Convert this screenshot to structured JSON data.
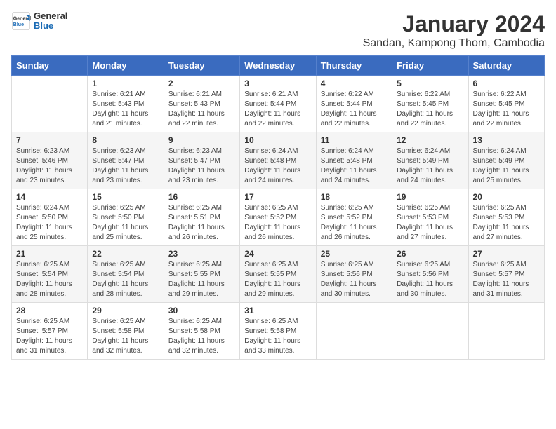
{
  "logo": {
    "general": "General",
    "blue": "Blue"
  },
  "title": "January 2024",
  "location": "Sandan, Kampong Thom, Cambodia",
  "days_of_week": [
    "Sunday",
    "Monday",
    "Tuesday",
    "Wednesday",
    "Thursday",
    "Friday",
    "Saturday"
  ],
  "weeks": [
    [
      {
        "day": "",
        "info": ""
      },
      {
        "day": "1",
        "info": "Sunrise: 6:21 AM\nSunset: 5:43 PM\nDaylight: 11 hours\nand 21 minutes."
      },
      {
        "day": "2",
        "info": "Sunrise: 6:21 AM\nSunset: 5:43 PM\nDaylight: 11 hours\nand 22 minutes."
      },
      {
        "day": "3",
        "info": "Sunrise: 6:21 AM\nSunset: 5:44 PM\nDaylight: 11 hours\nand 22 minutes."
      },
      {
        "day": "4",
        "info": "Sunrise: 6:22 AM\nSunset: 5:44 PM\nDaylight: 11 hours\nand 22 minutes."
      },
      {
        "day": "5",
        "info": "Sunrise: 6:22 AM\nSunset: 5:45 PM\nDaylight: 11 hours\nand 22 minutes."
      },
      {
        "day": "6",
        "info": "Sunrise: 6:22 AM\nSunset: 5:45 PM\nDaylight: 11 hours\nand 22 minutes."
      }
    ],
    [
      {
        "day": "7",
        "info": "Sunrise: 6:23 AM\nSunset: 5:46 PM\nDaylight: 11 hours\nand 23 minutes."
      },
      {
        "day": "8",
        "info": "Sunrise: 6:23 AM\nSunset: 5:47 PM\nDaylight: 11 hours\nand 23 minutes."
      },
      {
        "day": "9",
        "info": "Sunrise: 6:23 AM\nSunset: 5:47 PM\nDaylight: 11 hours\nand 23 minutes."
      },
      {
        "day": "10",
        "info": "Sunrise: 6:24 AM\nSunset: 5:48 PM\nDaylight: 11 hours\nand 24 minutes."
      },
      {
        "day": "11",
        "info": "Sunrise: 6:24 AM\nSunset: 5:48 PM\nDaylight: 11 hours\nand 24 minutes."
      },
      {
        "day": "12",
        "info": "Sunrise: 6:24 AM\nSunset: 5:49 PM\nDaylight: 11 hours\nand 24 minutes."
      },
      {
        "day": "13",
        "info": "Sunrise: 6:24 AM\nSunset: 5:49 PM\nDaylight: 11 hours\nand 25 minutes."
      }
    ],
    [
      {
        "day": "14",
        "info": "Sunrise: 6:24 AM\nSunset: 5:50 PM\nDaylight: 11 hours\nand 25 minutes."
      },
      {
        "day": "15",
        "info": "Sunrise: 6:25 AM\nSunset: 5:50 PM\nDaylight: 11 hours\nand 25 minutes."
      },
      {
        "day": "16",
        "info": "Sunrise: 6:25 AM\nSunset: 5:51 PM\nDaylight: 11 hours\nand 26 minutes."
      },
      {
        "day": "17",
        "info": "Sunrise: 6:25 AM\nSunset: 5:52 PM\nDaylight: 11 hours\nand 26 minutes."
      },
      {
        "day": "18",
        "info": "Sunrise: 6:25 AM\nSunset: 5:52 PM\nDaylight: 11 hours\nand 26 minutes."
      },
      {
        "day": "19",
        "info": "Sunrise: 6:25 AM\nSunset: 5:53 PM\nDaylight: 11 hours\nand 27 minutes."
      },
      {
        "day": "20",
        "info": "Sunrise: 6:25 AM\nSunset: 5:53 PM\nDaylight: 11 hours\nand 27 minutes."
      }
    ],
    [
      {
        "day": "21",
        "info": "Sunrise: 6:25 AM\nSunset: 5:54 PM\nDaylight: 11 hours\nand 28 minutes."
      },
      {
        "day": "22",
        "info": "Sunrise: 6:25 AM\nSunset: 5:54 PM\nDaylight: 11 hours\nand 28 minutes."
      },
      {
        "day": "23",
        "info": "Sunrise: 6:25 AM\nSunset: 5:55 PM\nDaylight: 11 hours\nand 29 minutes."
      },
      {
        "day": "24",
        "info": "Sunrise: 6:25 AM\nSunset: 5:55 PM\nDaylight: 11 hours\nand 29 minutes."
      },
      {
        "day": "25",
        "info": "Sunrise: 6:25 AM\nSunset: 5:56 PM\nDaylight: 11 hours\nand 30 minutes."
      },
      {
        "day": "26",
        "info": "Sunrise: 6:25 AM\nSunset: 5:56 PM\nDaylight: 11 hours\nand 30 minutes."
      },
      {
        "day": "27",
        "info": "Sunrise: 6:25 AM\nSunset: 5:57 PM\nDaylight: 11 hours\nand 31 minutes."
      }
    ],
    [
      {
        "day": "28",
        "info": "Sunrise: 6:25 AM\nSunset: 5:57 PM\nDaylight: 11 hours\nand 31 minutes."
      },
      {
        "day": "29",
        "info": "Sunrise: 6:25 AM\nSunset: 5:58 PM\nDaylight: 11 hours\nand 32 minutes."
      },
      {
        "day": "30",
        "info": "Sunrise: 6:25 AM\nSunset: 5:58 PM\nDaylight: 11 hours\nand 32 minutes."
      },
      {
        "day": "31",
        "info": "Sunrise: 6:25 AM\nSunset: 5:58 PM\nDaylight: 11 hours\nand 33 minutes."
      },
      {
        "day": "",
        "info": ""
      },
      {
        "day": "",
        "info": ""
      },
      {
        "day": "",
        "info": ""
      }
    ]
  ]
}
